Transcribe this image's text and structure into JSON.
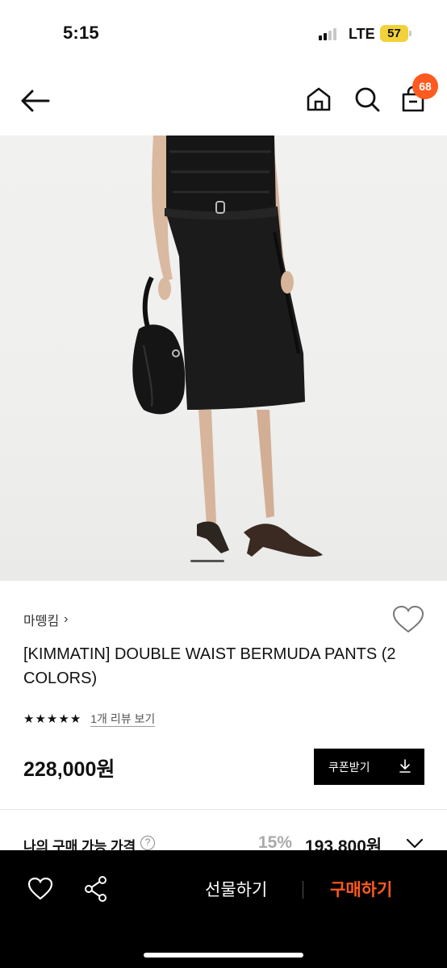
{
  "status_bar": {
    "time": "5:15",
    "network": "LTE",
    "battery": "57"
  },
  "nav": {
    "back_icon": "arrow-left-icon",
    "home_icon": "home-icon",
    "search_icon": "search-icon",
    "cart_icon": "cart-icon",
    "cart_badge": "68",
    "badge_color": "#ff5a1f"
  },
  "product": {
    "brand": "마뗑킴",
    "brand_chevron": "›",
    "title": "[KIMMATIN] DOUBLE WAIST BERMUDA PANTS (2 COLORS)",
    "rating_stars": 5,
    "review_link": "1개 리뷰 보기",
    "price": "228,000원",
    "coupon_label": "쿠폰받기",
    "coupon_icon": "download-icon",
    "wish_icon": "heart-outline-icon"
  },
  "buy_price": {
    "label": "나의 구매 가능 가격",
    "help": "?",
    "discount": "15%",
    "price": "193,800원",
    "chevron_icon": "chevron-down-icon"
  },
  "bottom_bar": {
    "wish_icon": "heart-outline-icon",
    "share_icon": "share-icon",
    "gift_label": "선물하기",
    "purchase_label": "구매하기",
    "accent_color": "#ff5a1f"
  }
}
